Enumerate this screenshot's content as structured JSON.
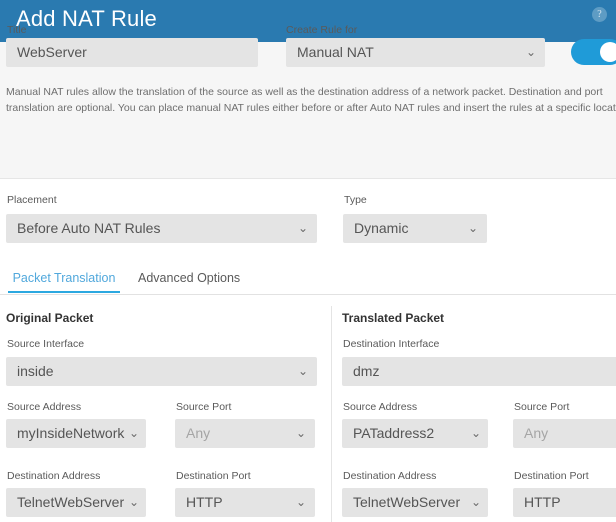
{
  "header": {
    "title": "Add NAT Rule",
    "help_icon": "question-mark-icon",
    "help_glyph": "?",
    "background_color": "#2a7ab0"
  },
  "form": {
    "title_label": "Title",
    "title_value": "WebServer",
    "create_rule_for_label": "Create Rule for",
    "create_rule_for_value": "Manual NAT",
    "enable_toggle_state": "on",
    "toggle_color": "#1f9bd8",
    "description": "Manual NAT rules allow the translation of the source as well as the destination address of a network packet. Destination and port translation are optional. You can place manual NAT rules either before or after Auto NAT rules and insert the rules at a specific location.",
    "placement_label": "Placement",
    "placement_value": "Before Auto NAT Rules",
    "type_label": "Type",
    "type_value": "Dynamic"
  },
  "tabs": {
    "active_color": "#2ba8e0",
    "items": [
      {
        "label": "Packet Translation",
        "active": true
      },
      {
        "label": "Advanced Options",
        "active": false
      }
    ]
  },
  "original_packet": {
    "heading": "Original Packet",
    "source_interface_label": "Source Interface",
    "source_interface_value": "inside",
    "source_address_label": "Source Address",
    "source_address_value": "myInsideNetwork",
    "source_port_label": "Source Port",
    "source_port_value": "Any",
    "destination_address_label": "Destination Address",
    "destination_address_value": "TelnetWebServer",
    "destination_port_label": "Destination Port",
    "destination_port_value": "HTTP"
  },
  "translated_packet": {
    "heading": "Translated Packet",
    "destination_interface_label": "Destination Interface",
    "destination_interface_value": "dmz",
    "source_address_label": "Source Address",
    "source_address_value": "PATaddress2",
    "source_port_label": "Source Port",
    "source_port_value": "Any",
    "destination_address_label": "Destination Address",
    "destination_address_value": "TelnetWebServer",
    "destination_port_label": "Destination Port",
    "destination_port_value": "HTTP"
  },
  "icons": {
    "chevron_down": "⌄"
  }
}
